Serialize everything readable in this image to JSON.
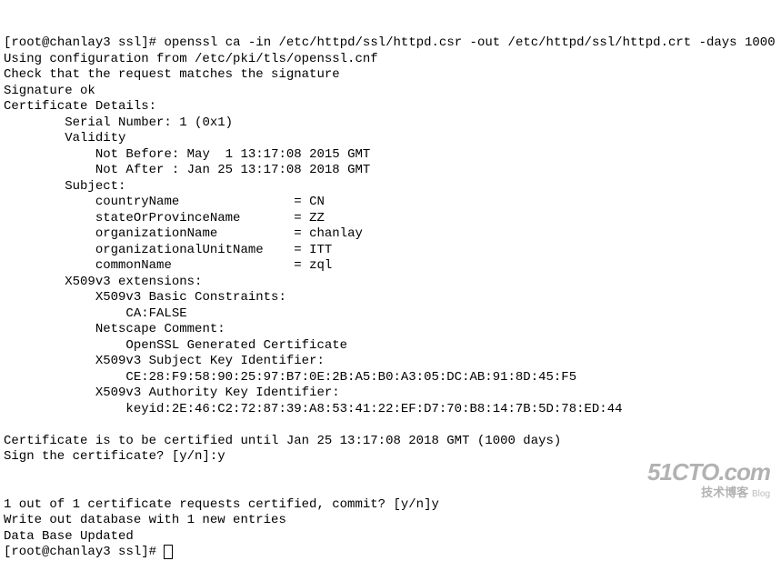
{
  "prompt1_user": "root",
  "prompt1_host": "chanlay3",
  "prompt1_dir": "ssl",
  "cmd1": "openssl ca -in /etc/httpd/ssl/httpd.csr -out /etc/httpd/ssl/httpd.crt -days 1000",
  "line_config": "Using configuration from /etc/pki/tls/openssl.cnf",
  "line_check": "Check that the request matches the signature",
  "line_sigok": "Signature ok",
  "line_certdet": "Certificate Details:",
  "serial_label": "Serial Number:",
  "serial_value": "1 (0x1)",
  "validity_label": "Validity",
  "not_before_label": "Not Before:",
  "not_before_value": "May  1 13:17:08 2015 GMT",
  "not_after_label": "Not After :",
  "not_after_value": "Jan 25 13:17:08 2018 GMT",
  "subject_label": "Subject:",
  "subj_countryName_k": "countryName",
  "subj_countryName_v": "CN",
  "subj_state_k": "stateOrProvinceName",
  "subj_state_v": "ZZ",
  "subj_org_k": "organizationName",
  "subj_org_v": "chanlay",
  "subj_ou_k": "organizationalUnitName",
  "subj_ou_v": "ITT",
  "subj_cn_k": "commonName",
  "subj_cn_v": "zql",
  "ext_label": "X509v3 extensions:",
  "ext_bc": "X509v3 Basic Constraints:",
  "ext_bc_val": "CA:FALSE",
  "ext_nc": "Netscape Comment:",
  "ext_nc_val": "OpenSSL Generated Certificate",
  "ext_ski": "X509v3 Subject Key Identifier:",
  "ext_ski_val": "CE:28:F9:58:90:25:97:B7:0E:2B:A5:B0:A3:05:DC:AB:91:8D:45:F5",
  "ext_aki": "X509v3 Authority Key Identifier:",
  "ext_aki_val": "keyid:2E:46:C2:72:87:39:A8:53:41:22:EF:D7:70:B8:14:7B:5D:78:ED:44",
  "cert_until": "Certificate is to be certified until Jan 25 13:17:08 2018 GMT (1000 days)",
  "sign_prompt": "Sign the certificate? [y/n]:",
  "sign_answer": "y",
  "commit_prompt": "1 out of 1 certificate requests certified, commit? [y/n]",
  "commit_answer": "y",
  "write_db": "Write out database with 1 new entries",
  "db_updated": "Data Base Updated",
  "prompt2_user": "root",
  "prompt2_host": "chanlay3",
  "prompt2_dir": "ssl",
  "wm_main": "51CTO.com",
  "wm_sub": "技术博客",
  "wm_blog": "Blog"
}
